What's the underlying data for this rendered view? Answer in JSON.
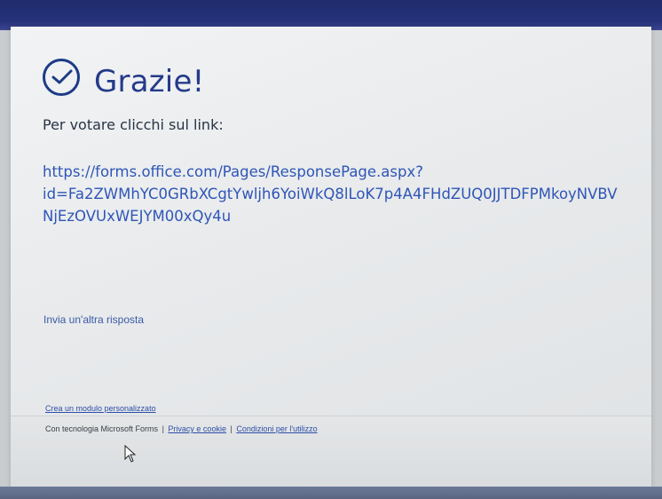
{
  "page": {
    "title": "Grazie!",
    "prompt": "Per votare clicchi sul link:",
    "link_lines": [
      "https://forms.office.com/Pages/ResponsePage.aspx?",
      "id=Fa2ZWMhYC0GRbXCgtYwljh6YoiWkQ8lLoK7p4A4FHdZUQ0JJTDFPMkoyNVBV",
      "NjEzOVUxWEJYM00xQy4u"
    ],
    "another_response": "Invia un'altra risposta"
  },
  "footer": {
    "custom_form": "Crea un modulo personalizzato",
    "powered_by": "Con tecnologia Microsoft Forms",
    "privacy": "Privacy e cookie",
    "terms": "Condizioni per l'utilizzo",
    "separator": "|"
  },
  "icons": {
    "success": "check-circle-icon",
    "cursor": "mouse-pointer-icon"
  },
  "colors": {
    "title": "#243a8a",
    "link": "#2f56b6",
    "text": "#283444"
  }
}
